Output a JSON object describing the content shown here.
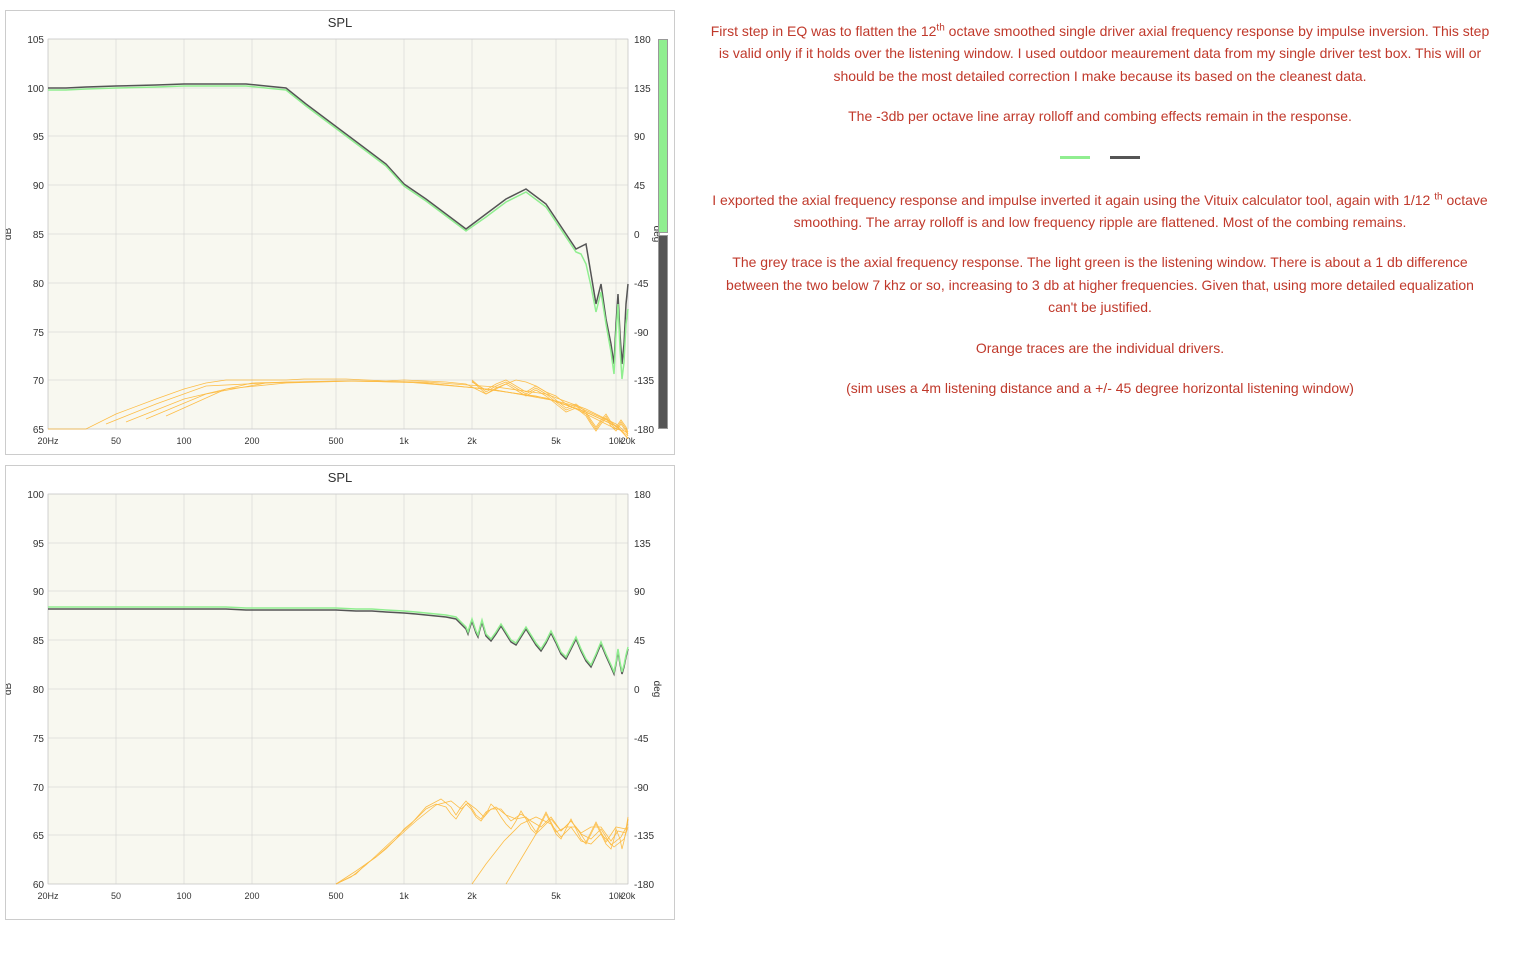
{
  "charts": {
    "top": {
      "title": "SPL",
      "y_left_label": "dB",
      "y_right_label": "deg",
      "y_left_values": [
        "105",
        "100",
        "95",
        "90",
        "85",
        "80",
        "75",
        "70",
        "65"
      ],
      "y_right_values": [
        "180",
        "135",
        "90",
        "45",
        "0",
        "-45",
        "-90",
        "-135",
        "-180"
      ],
      "x_values": [
        "20Hz",
        "50",
        "100",
        "200",
        "500",
        "1k",
        "2k",
        "5k",
        "10k",
        "20k"
      ]
    },
    "bottom": {
      "title": "SPL",
      "y_left_label": "dB",
      "y_right_label": "deg",
      "y_left_values": [
        "100",
        "95",
        "90",
        "85",
        "80",
        "75",
        "70",
        "65",
        "60"
      ],
      "y_right_values": [
        "180",
        "135",
        "90",
        "45",
        "0",
        "-45",
        "-90",
        "-135",
        "-180"
      ],
      "x_values": [
        "20Hz",
        "50",
        "100",
        "200",
        "500",
        "1k",
        "2k",
        "5k",
        "10k",
        "20k"
      ]
    }
  },
  "legend": {
    "green_label": "green trace",
    "grey_label": "grey trace"
  },
  "text_top": {
    "paragraph1": "First step in EQ was to flatten the 12th octave smoothed single driver axial frequency response by impulse inversion.  This step is valid only if it holds over the listening window.  I used outdoor meaurement data from my single driver test box.  This will or should be the most detailed correction I make because its based on the cleanest data.",
    "paragraph2": "The -3db per octave line array rolloff and combing effects remain in the response."
  },
  "text_bottom": {
    "paragraph1": "I exported the axial frequency response and impulse inverted it again using the Vituix calculator tool, again with 1/12th octave smoothing.  The array rolloff is and low frequency ripple are flattened.  Most of the combing remains.",
    "paragraph2": "The grey trace is the axial frequency response.  The light green is the listening window.  There is about a 1 db difference between the two below 7 khz or so, increasing to 3 db at higher frequencies.  Given that, using more detailed equalization can't be justified.",
    "paragraph3": "Orange traces are the individual drivers.",
    "paragraph4": "(sim uses a 4m listening distance and a +/- 45 degree horizontal listening window)"
  }
}
